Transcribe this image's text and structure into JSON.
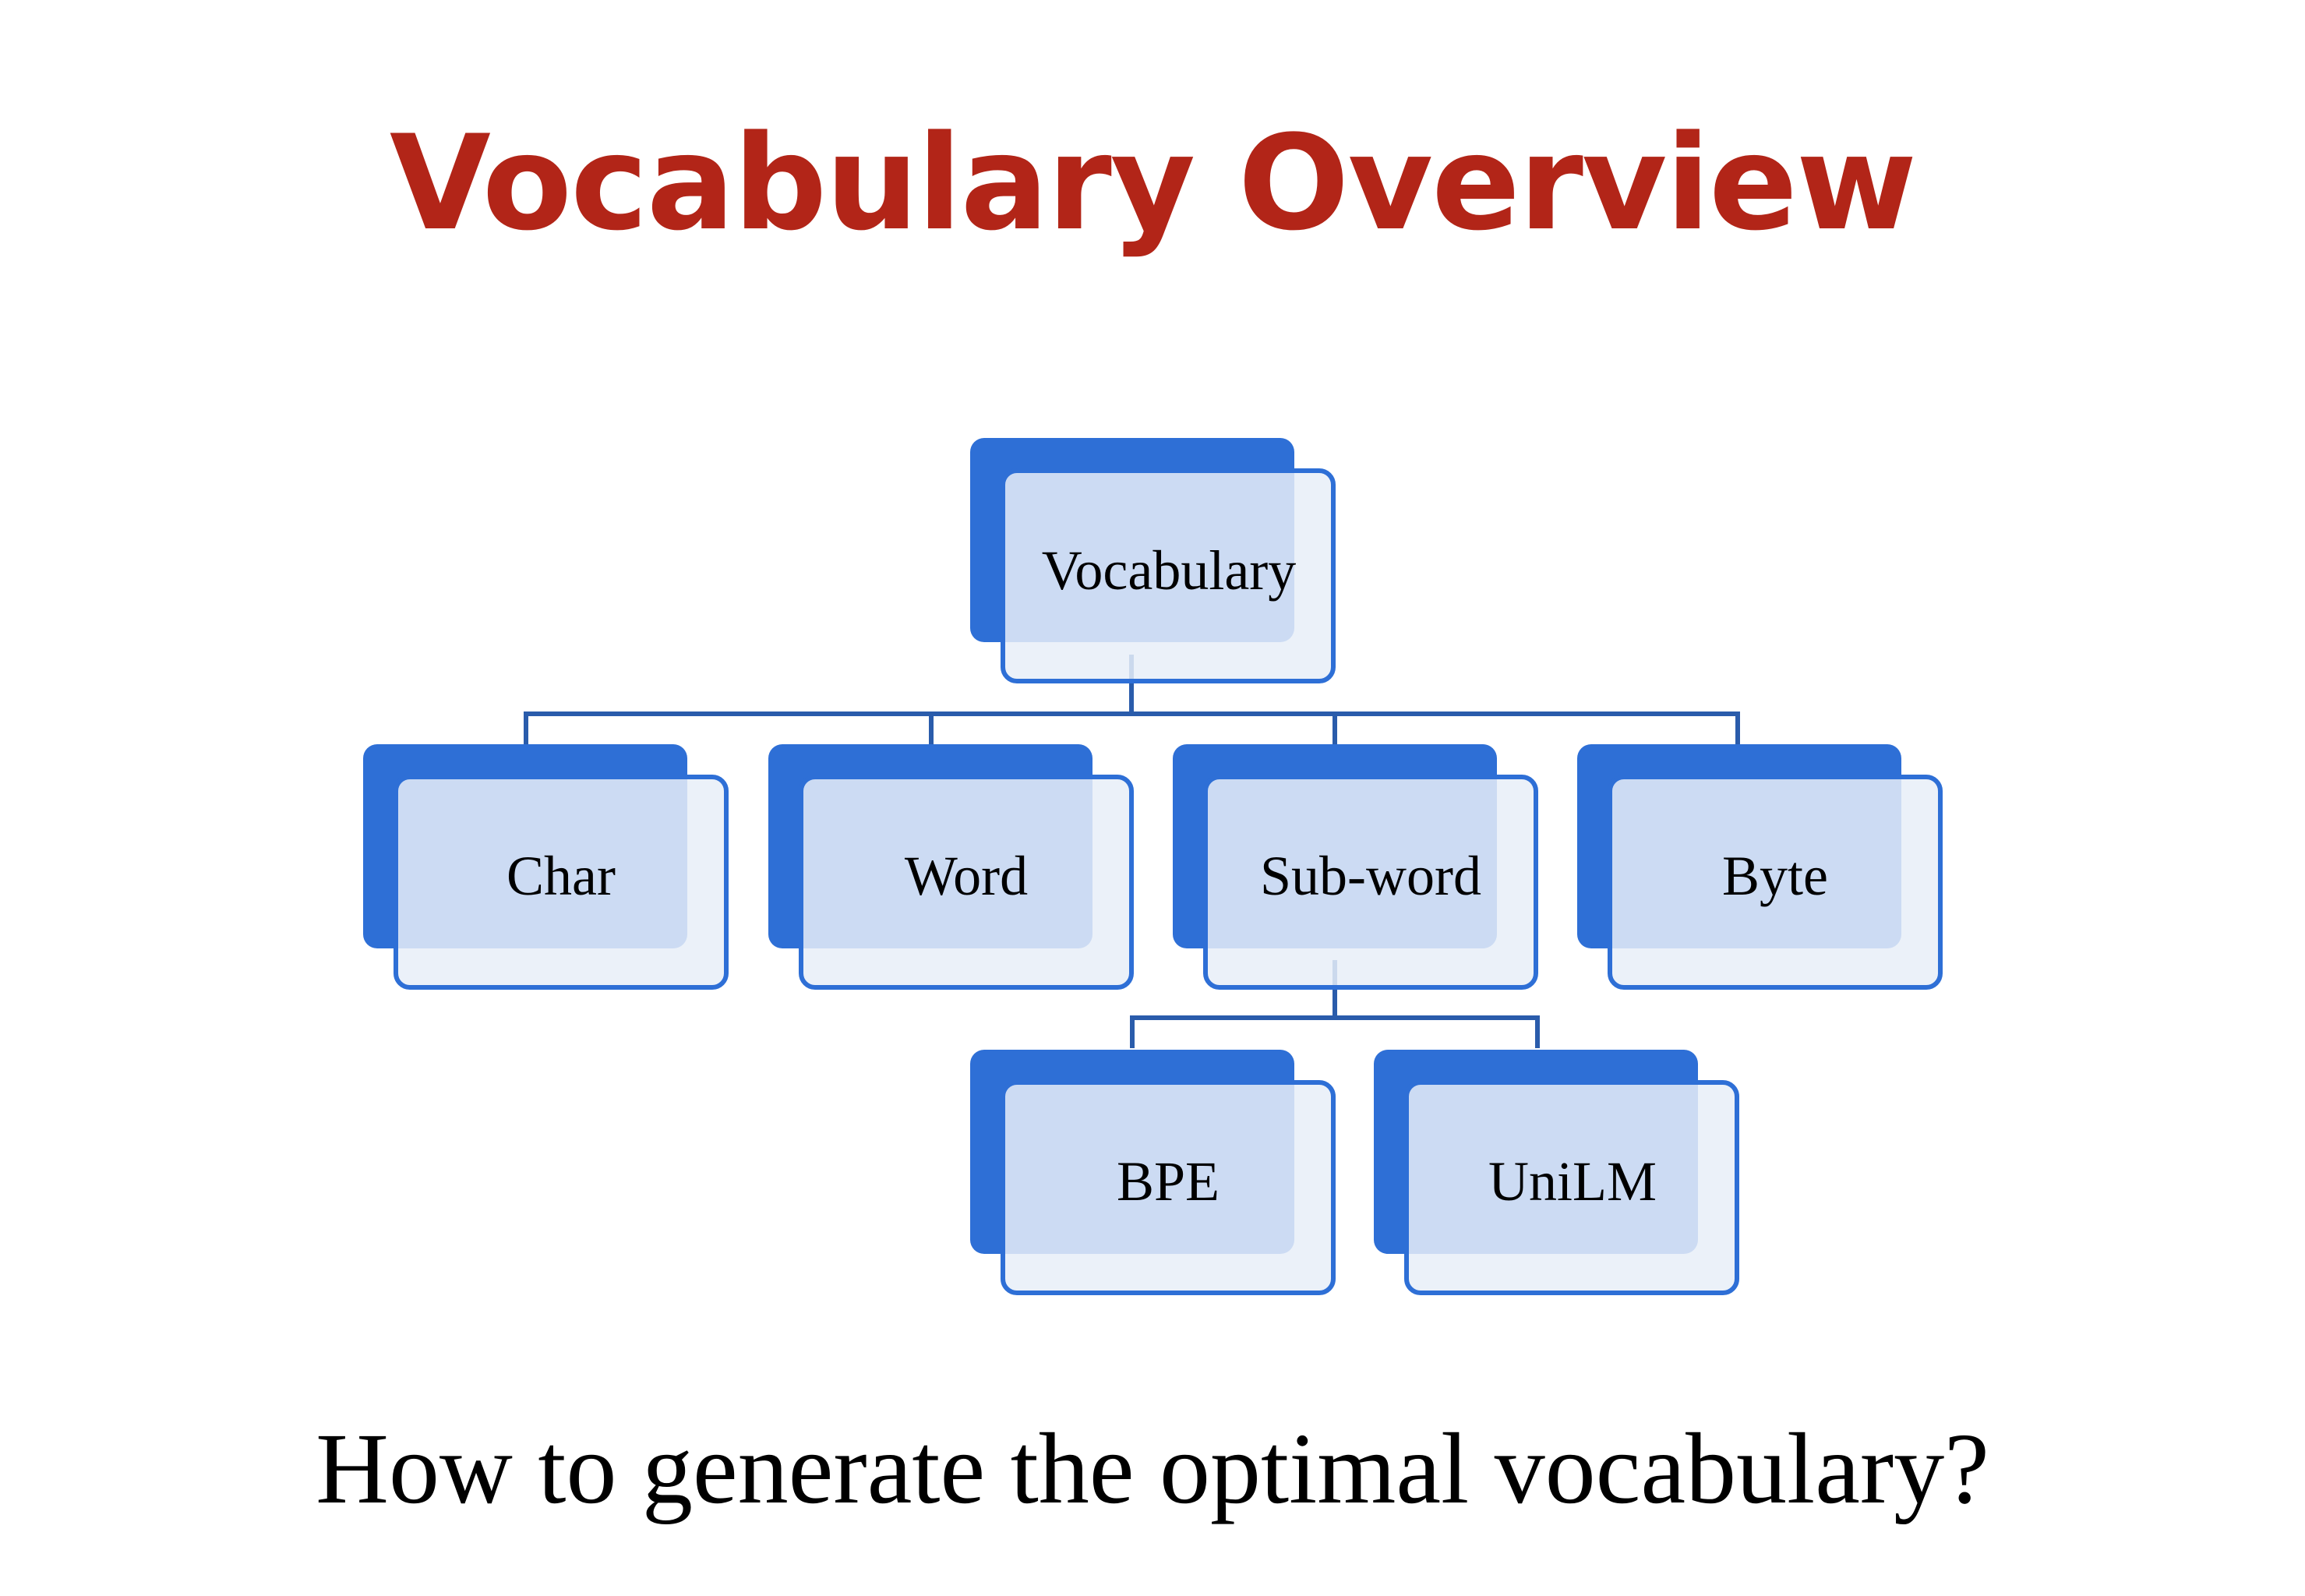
{
  "slide": {
    "title": "Vocabulary Overview",
    "question": "How to generate the optimal vocabulary?"
  },
  "diagram": {
    "root": "Vocabulary",
    "level1": [
      "Char",
      "Word",
      "Sub-word",
      "Byte"
    ],
    "subword_children": [
      "BPE",
      "UniLM"
    ]
  },
  "colors": {
    "title": "#b22518",
    "node_fill_back": "#2e6fd6",
    "node_fill_front": "#e8eef8",
    "node_border": "#2e6fd6",
    "connector": "#2a5cab"
  }
}
